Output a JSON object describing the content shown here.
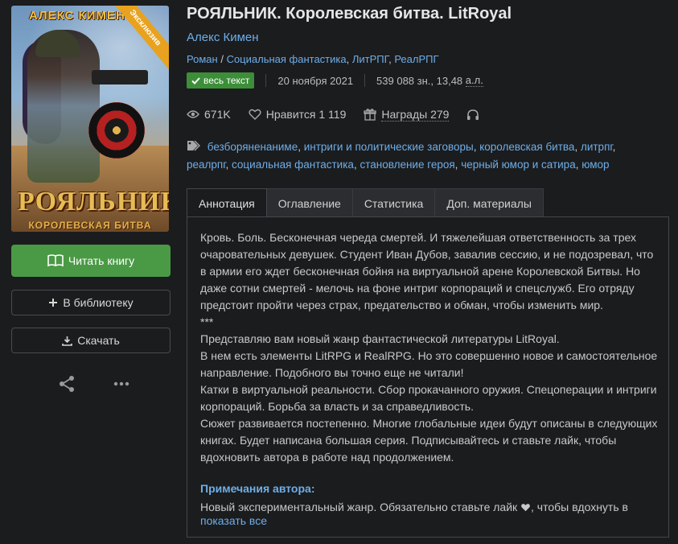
{
  "cover": {
    "author_text": "АЛЕКС КИМЕН",
    "ribbon_text": "Эксклюзив",
    "title_text": "РОЯЛЬНИК",
    "subtitle_text": "КОРОЛЕВСКАЯ БИТВА"
  },
  "actions": {
    "read_label": "Читать книгу",
    "library_label": "В библиотеку",
    "download_label": "Скачать",
    "share_icon": "share-icon",
    "more_icon": "more-icon"
  },
  "book": {
    "title": "РОЯЛЬНИК. Королевская битва. LitRoyal",
    "author": "Алекс Кимен",
    "genres": [
      "Роман",
      "Социальная фантастика",
      "ЛитРПГ",
      "РеалРПГ"
    ],
    "genre_separator": "/",
    "genre_comma": ",",
    "full_text_badge": "весь текст",
    "date": "20 ноября 2021",
    "size_chars": "539 088 зн., 13,48",
    "size_unit": "а.л."
  },
  "stats": {
    "views": "671K",
    "likes_label": "Нравится 1 119",
    "awards_label": "Награды 279"
  },
  "tags": [
    "безборяненаниме",
    "интриги и политические заговоры",
    "королевская битва",
    "литрпг",
    "реалрпг",
    "социальная фантастика",
    "становление героя",
    "черный юмор и сатира",
    "юмор"
  ],
  "tabs": [
    {
      "label": "Аннотация",
      "active": true
    },
    {
      "label": "Оглавление",
      "active": false
    },
    {
      "label": "Статистика",
      "active": false
    },
    {
      "label": "Доп. материалы",
      "active": false
    }
  ],
  "annotation": [
    "Кровь. Боль. Бесконечная череда смертей. И тяжелейшая ответственность за трех очаровательных девушек. Студент Иван Дубов, завалив сессию, и не подозревал, что в армии его ждет бесконечная бойня на виртуальной арене Королевской Битвы. Но даже сотни смертей - мелочь на фоне интриг корпораций и спецслужб. Его отряду предстоит пройти через страх, предательство и обман, чтобы изменить мир.",
    "***",
    "Представляю вам новый жанр фантастической литературы LitRoyal.",
    "В нем есть элементы LitRPG и RealRPG. Но это совершенно новое и самостоятельное направление. Подобного вы точно еще не читали!",
    "Катки в виртуальной реальности. Сбор прокачанного оружия. Спецоперации и интриги корпораций. Борьба за власть и за справедливость.",
    "Сюжет развивается постепенно. Многие глобальные идеи будут описаны в следующих книгах. Будет написана большая серия. Подписывайтесь и ставьте лайк, чтобы вдохновить автора в работе над продолжением."
  ],
  "notes": {
    "title": "Примечания автора:",
    "text_before": "Новый экспериментальный жанр. Обязательно ставьте лайк",
    "text_after": ", чтобы вдохнуть в",
    "show_all": "показать все"
  },
  "colors": {
    "background": "#1b1c1e",
    "link": "#6eaee8",
    "accent_green": "#4a9a45",
    "badge_green": "#3c8f38"
  }
}
